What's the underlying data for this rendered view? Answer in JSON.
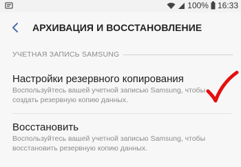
{
  "status_bar": {
    "battery_percent": "100%",
    "time": "16:33",
    "icons": [
      "notification-icon",
      "wifi-icon",
      "signal-icon",
      "battery-icon"
    ]
  },
  "header": {
    "back_icon": "chevron-left-icon",
    "title": "АРХИВАЦИЯ И ВОССТАНОВЛЕНИЕ"
  },
  "section": {
    "label": "УЧЕТНАЯ ЗАПИСЬ SAMSUNG"
  },
  "items": [
    {
      "title": "Настройки резервного копирования",
      "description": "Воспользуйтесь вашей учетной записью Samsung, чтобы создать резервную копию данных."
    },
    {
      "title": "Восстановить",
      "description": "Воспользуйтесь вашей учетной записью Samsung, чтобы восстановить резервную копию данных."
    }
  ],
  "annotation": {
    "mark": "red-checkmark",
    "color": "#e31010"
  },
  "colors": {
    "background": "#f7f7f7",
    "title_text": "#222222",
    "secondary_text": "#8c8c8c",
    "accent": "#4a6fa5"
  }
}
